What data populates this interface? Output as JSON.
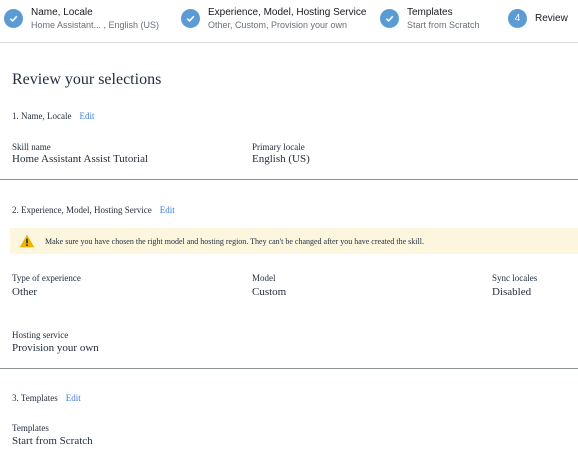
{
  "steps": [
    {
      "title": "Name, Locale",
      "subtitle": "Home Assistant... , English (US)"
    },
    {
      "title": "Experience, Model, Hosting Service",
      "subtitle": "Other, Custom, Provision your own"
    },
    {
      "title": "Templates",
      "subtitle": "Start from Scratch"
    },
    {
      "number": "4",
      "title": "Review"
    }
  ],
  "page_title": "Review your selections",
  "edit_label": "Edit",
  "section1": {
    "heading": "1. Name, Locale",
    "skill_name_label": "Skill name",
    "skill_name_value": "Home Assistant Assist Tutorial",
    "locale_label": "Primary locale",
    "locale_value": "English (US)"
  },
  "section2": {
    "heading": "2. Experience, Model, Hosting Service",
    "alert": "Make sure you have chosen the right model and hosting region. They can't be changed after you have created the skill.",
    "experience_label": "Type of experience",
    "experience_value": "Other",
    "model_label": "Model",
    "model_value": "Custom",
    "sync_label": "Sync locales",
    "sync_value": "Disabled",
    "hosting_label": "Hosting service",
    "hosting_value": "Provision your own"
  },
  "section3": {
    "heading": "3. Templates",
    "templates_label": "Templates",
    "templates_value": "Start from Scratch"
  },
  "colors": {
    "step_circle": "#5b9bd5",
    "link": "#3b7ddd",
    "alert_bg": "#fcf6df",
    "warning": "#f0b400"
  }
}
